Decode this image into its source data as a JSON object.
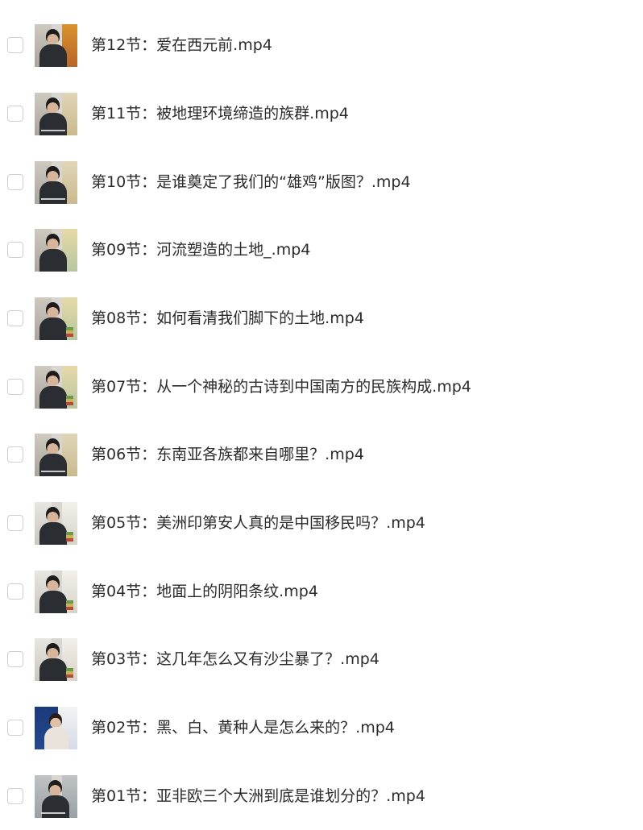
{
  "files": [
    {
      "name": "第12节：爱在西元前.mp4",
      "thumbnail": "video-thumbnail-presenter",
      "checked": false
    },
    {
      "name": "第11节：被地理环境缔造的族群.mp4",
      "thumbnail": "video-thumbnail-presenter",
      "checked": false
    },
    {
      "name": "第10节：是谁奠定了我们的“雄鸡”版图？.mp4",
      "thumbnail": "video-thumbnail-presenter",
      "checked": false
    },
    {
      "name": "第09节：河流塑造的土地_.mp4",
      "thumbnail": "video-thumbnail-presenter",
      "checked": false
    },
    {
      "name": "第08节：如何看清我们脚下的土地.mp4",
      "thumbnail": "video-thumbnail-presenter",
      "checked": false
    },
    {
      "name": "第07节：从一个神秘的古诗到中国南方的民族构成.mp4",
      "thumbnail": "video-thumbnail-presenter",
      "checked": false
    },
    {
      "name": "第06节：东南亚各族都来自哪里？.mp4",
      "thumbnail": "video-thumbnail-presenter",
      "checked": false
    },
    {
      "name": "第05节：美洲印第安人真的是中国移民吗？.mp4",
      "thumbnail": "video-thumbnail-presenter",
      "checked": false
    },
    {
      "name": "第04节：地面上的阴阳条纹.mp4",
      "thumbnail": "video-thumbnail-presenter",
      "checked": false
    },
    {
      "name": "第03节：这几年怎么又有沙尘暴了？.mp4",
      "thumbnail": "video-thumbnail-presenter",
      "checked": false
    },
    {
      "name": "第02节：黑、白、黄种人是怎么来的？.mp4",
      "thumbnail": "video-thumbnail-presenter",
      "checked": false
    },
    {
      "name": "第01节：亚非欧三个大洲到底是谁划分的？.mp4",
      "thumbnail": "video-thumbnail-presenter",
      "checked": false
    }
  ]
}
